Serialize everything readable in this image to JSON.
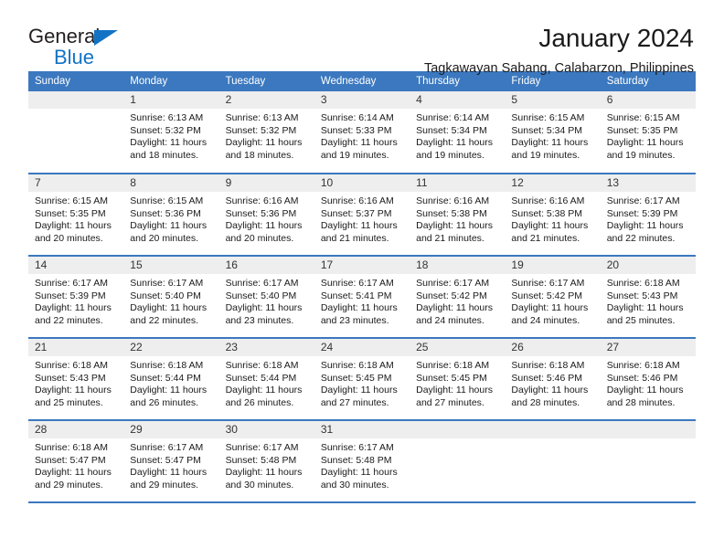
{
  "brand": {
    "word_general": "General",
    "word_blue": "Blue",
    "accent_color": "#1273c4"
  },
  "header": {
    "title": "January 2024",
    "subtitle": "Tagkawayan Sabang, Calabarzon, Philippines"
  },
  "calendar": {
    "header_color": "#3b78bf",
    "daynum_bg": "#eeeeee",
    "weekday_headers": [
      "Sunday",
      "Monday",
      "Tuesday",
      "Wednesday",
      "Thursday",
      "Friday",
      "Saturday"
    ],
    "weeks": [
      [
        {
          "day": "",
          "sunrise": "",
          "sunset": "",
          "daylight_l1": "",
          "daylight_l2": ""
        },
        {
          "day": "1",
          "sunrise": "Sunrise: 6:13 AM",
          "sunset": "Sunset: 5:32 PM",
          "daylight_l1": "Daylight: 11 hours",
          "daylight_l2": "and 18 minutes."
        },
        {
          "day": "2",
          "sunrise": "Sunrise: 6:13 AM",
          "sunset": "Sunset: 5:32 PM",
          "daylight_l1": "Daylight: 11 hours",
          "daylight_l2": "and 18 minutes."
        },
        {
          "day": "3",
          "sunrise": "Sunrise: 6:14 AM",
          "sunset": "Sunset: 5:33 PM",
          "daylight_l1": "Daylight: 11 hours",
          "daylight_l2": "and 19 minutes."
        },
        {
          "day": "4",
          "sunrise": "Sunrise: 6:14 AM",
          "sunset": "Sunset: 5:34 PM",
          "daylight_l1": "Daylight: 11 hours",
          "daylight_l2": "and 19 minutes."
        },
        {
          "day": "5",
          "sunrise": "Sunrise: 6:15 AM",
          "sunset": "Sunset: 5:34 PM",
          "daylight_l1": "Daylight: 11 hours",
          "daylight_l2": "and 19 minutes."
        },
        {
          "day": "6",
          "sunrise": "Sunrise: 6:15 AM",
          "sunset": "Sunset: 5:35 PM",
          "daylight_l1": "Daylight: 11 hours",
          "daylight_l2": "and 19 minutes."
        }
      ],
      [
        {
          "day": "7",
          "sunrise": "Sunrise: 6:15 AM",
          "sunset": "Sunset: 5:35 PM",
          "daylight_l1": "Daylight: 11 hours",
          "daylight_l2": "and 20 minutes."
        },
        {
          "day": "8",
          "sunrise": "Sunrise: 6:15 AM",
          "sunset": "Sunset: 5:36 PM",
          "daylight_l1": "Daylight: 11 hours",
          "daylight_l2": "and 20 minutes."
        },
        {
          "day": "9",
          "sunrise": "Sunrise: 6:16 AM",
          "sunset": "Sunset: 5:36 PM",
          "daylight_l1": "Daylight: 11 hours",
          "daylight_l2": "and 20 minutes."
        },
        {
          "day": "10",
          "sunrise": "Sunrise: 6:16 AM",
          "sunset": "Sunset: 5:37 PM",
          "daylight_l1": "Daylight: 11 hours",
          "daylight_l2": "and 21 minutes."
        },
        {
          "day": "11",
          "sunrise": "Sunrise: 6:16 AM",
          "sunset": "Sunset: 5:38 PM",
          "daylight_l1": "Daylight: 11 hours",
          "daylight_l2": "and 21 minutes."
        },
        {
          "day": "12",
          "sunrise": "Sunrise: 6:16 AM",
          "sunset": "Sunset: 5:38 PM",
          "daylight_l1": "Daylight: 11 hours",
          "daylight_l2": "and 21 minutes."
        },
        {
          "day": "13",
          "sunrise": "Sunrise: 6:17 AM",
          "sunset": "Sunset: 5:39 PM",
          "daylight_l1": "Daylight: 11 hours",
          "daylight_l2": "and 22 minutes."
        }
      ],
      [
        {
          "day": "14",
          "sunrise": "Sunrise: 6:17 AM",
          "sunset": "Sunset: 5:39 PM",
          "daylight_l1": "Daylight: 11 hours",
          "daylight_l2": "and 22 minutes."
        },
        {
          "day": "15",
          "sunrise": "Sunrise: 6:17 AM",
          "sunset": "Sunset: 5:40 PM",
          "daylight_l1": "Daylight: 11 hours",
          "daylight_l2": "and 22 minutes."
        },
        {
          "day": "16",
          "sunrise": "Sunrise: 6:17 AM",
          "sunset": "Sunset: 5:40 PM",
          "daylight_l1": "Daylight: 11 hours",
          "daylight_l2": "and 23 minutes."
        },
        {
          "day": "17",
          "sunrise": "Sunrise: 6:17 AM",
          "sunset": "Sunset: 5:41 PM",
          "daylight_l1": "Daylight: 11 hours",
          "daylight_l2": "and 23 minutes."
        },
        {
          "day": "18",
          "sunrise": "Sunrise: 6:17 AM",
          "sunset": "Sunset: 5:42 PM",
          "daylight_l1": "Daylight: 11 hours",
          "daylight_l2": "and 24 minutes."
        },
        {
          "day": "19",
          "sunrise": "Sunrise: 6:17 AM",
          "sunset": "Sunset: 5:42 PM",
          "daylight_l1": "Daylight: 11 hours",
          "daylight_l2": "and 24 minutes."
        },
        {
          "day": "20",
          "sunrise": "Sunrise: 6:18 AM",
          "sunset": "Sunset: 5:43 PM",
          "daylight_l1": "Daylight: 11 hours",
          "daylight_l2": "and 25 minutes."
        }
      ],
      [
        {
          "day": "21",
          "sunrise": "Sunrise: 6:18 AM",
          "sunset": "Sunset: 5:43 PM",
          "daylight_l1": "Daylight: 11 hours",
          "daylight_l2": "and 25 minutes."
        },
        {
          "day": "22",
          "sunrise": "Sunrise: 6:18 AM",
          "sunset": "Sunset: 5:44 PM",
          "daylight_l1": "Daylight: 11 hours",
          "daylight_l2": "and 26 minutes."
        },
        {
          "day": "23",
          "sunrise": "Sunrise: 6:18 AM",
          "sunset": "Sunset: 5:44 PM",
          "daylight_l1": "Daylight: 11 hours",
          "daylight_l2": "and 26 minutes."
        },
        {
          "day": "24",
          "sunrise": "Sunrise: 6:18 AM",
          "sunset": "Sunset: 5:45 PM",
          "daylight_l1": "Daylight: 11 hours",
          "daylight_l2": "and 27 minutes."
        },
        {
          "day": "25",
          "sunrise": "Sunrise: 6:18 AM",
          "sunset": "Sunset: 5:45 PM",
          "daylight_l1": "Daylight: 11 hours",
          "daylight_l2": "and 27 minutes."
        },
        {
          "day": "26",
          "sunrise": "Sunrise: 6:18 AM",
          "sunset": "Sunset: 5:46 PM",
          "daylight_l1": "Daylight: 11 hours",
          "daylight_l2": "and 28 minutes."
        },
        {
          "day": "27",
          "sunrise": "Sunrise: 6:18 AM",
          "sunset": "Sunset: 5:46 PM",
          "daylight_l1": "Daylight: 11 hours",
          "daylight_l2": "and 28 minutes."
        }
      ],
      [
        {
          "day": "28",
          "sunrise": "Sunrise: 6:18 AM",
          "sunset": "Sunset: 5:47 PM",
          "daylight_l1": "Daylight: 11 hours",
          "daylight_l2": "and 29 minutes."
        },
        {
          "day": "29",
          "sunrise": "Sunrise: 6:17 AM",
          "sunset": "Sunset: 5:47 PM",
          "daylight_l1": "Daylight: 11 hours",
          "daylight_l2": "and 29 minutes."
        },
        {
          "day": "30",
          "sunrise": "Sunrise: 6:17 AM",
          "sunset": "Sunset: 5:48 PM",
          "daylight_l1": "Daylight: 11 hours",
          "daylight_l2": "and 30 minutes."
        },
        {
          "day": "31",
          "sunrise": "Sunrise: 6:17 AM",
          "sunset": "Sunset: 5:48 PM",
          "daylight_l1": "Daylight: 11 hours",
          "daylight_l2": "and 30 minutes."
        },
        {
          "day": "",
          "sunrise": "",
          "sunset": "",
          "daylight_l1": "",
          "daylight_l2": ""
        },
        {
          "day": "",
          "sunrise": "",
          "sunset": "",
          "daylight_l1": "",
          "daylight_l2": ""
        },
        {
          "day": "",
          "sunrise": "",
          "sunset": "",
          "daylight_l1": "",
          "daylight_l2": ""
        }
      ]
    ]
  }
}
